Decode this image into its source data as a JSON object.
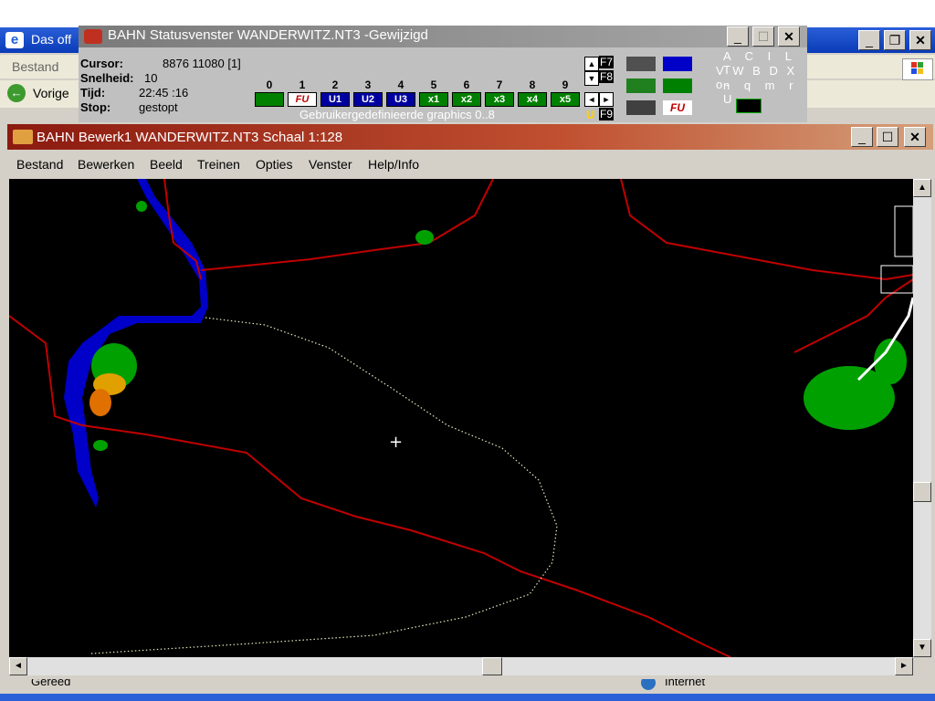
{
  "ie": {
    "title": "Das off",
    "menu_bestand": "Bestand",
    "back_label": "Vorige",
    "status_text": "Gereed",
    "zone_text": "Internet"
  },
  "status_window": {
    "title": "BAHN Statusvenster WANDERWITZ.NT3 -Gewijzigd",
    "cursor_label": "Cursor:",
    "cursor_value": "8876 11080 [1]",
    "speed_label": "Snelheid:",
    "speed_value": "10",
    "time_label": "Tijd:",
    "time_value": "22:45 :16",
    "stop_label": "Stop:",
    "stop_value": "gestopt",
    "digits": [
      "0",
      "1",
      "2",
      "3",
      "4",
      "5",
      "6",
      "7",
      "8",
      "9"
    ],
    "slots": [
      "",
      "FU",
      "U1",
      "U2",
      "U3",
      "x1",
      "x2",
      "x3",
      "x4",
      "x5"
    ],
    "graphics_caption": "Gebruikergedefinieerde graphics 0..8",
    "f7": "F7",
    "f8": "F8",
    "f9": "F9",
    "u_label": "U",
    "fu_label": "FU",
    "keys_row1": "A C I L T",
    "keys_row2": "V W B D X o-",
    "keys_row3": "n q m r U"
  },
  "bahn_window": {
    "title": "BAHN Bewerk1 WANDERWITZ.NT3 Schaal 1:128",
    "menu": [
      "Bestand",
      "Bewerken",
      "Beeld",
      "Treinen",
      "Opties",
      "Venster",
      "Help/Info"
    ],
    "scroll_up": "▲",
    "scroll_down": "▼",
    "scroll_left": "◄",
    "scroll_right": "►",
    "cursor_symbol": "+"
  },
  "colors": {
    "canvas": "#000000",
    "track": "#c00000",
    "river": "#0000c8",
    "forest": "#00a000"
  }
}
